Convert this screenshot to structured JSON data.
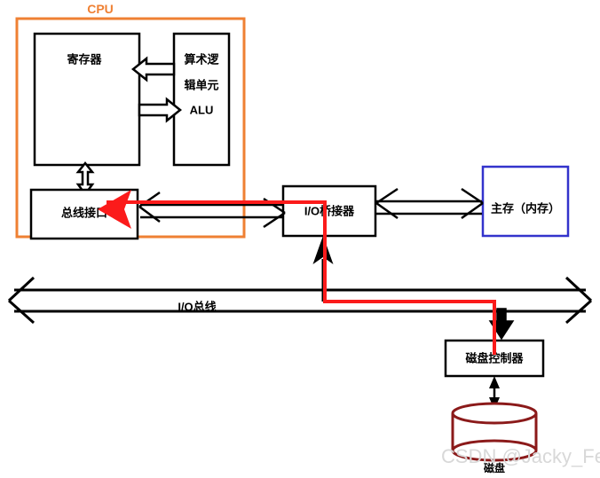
{
  "diagram": {
    "title_label": "CPU",
    "cpu_group": {
      "label": "CPU",
      "border_color": "#ef8033",
      "blocks": [
        {
          "id": "registers",
          "label": "寄存器"
        },
        {
          "id": "alu",
          "label_line1": "算术逻",
          "label_line2": "辑单元",
          "label_line3": "ALU"
        },
        {
          "id": "bus_interface",
          "label": "总线接口"
        }
      ]
    },
    "blocks": [
      {
        "id": "io_bridge",
        "label": "I/O桥接器",
        "border_color": "#000000"
      },
      {
        "id": "main_memory",
        "label": "主存（内存）",
        "border_color": "#3333cc"
      },
      {
        "id": "disk_controller",
        "label": "磁盘控制器",
        "border_color": "#000000"
      }
    ],
    "bus": {
      "id": "io_bus",
      "label": "I/O总线"
    },
    "disk": {
      "id": "disk",
      "label": "磁盘",
      "color": "#8b1a1a"
    },
    "watermark": "CSDN @Jacky_Feng",
    "colors": {
      "cpu_border": "#ef8033",
      "memory_border": "#3333cc",
      "data_path": "#fb1b1b",
      "disk": "#8b1a1a",
      "default_stroke": "#000000"
    }
  }
}
